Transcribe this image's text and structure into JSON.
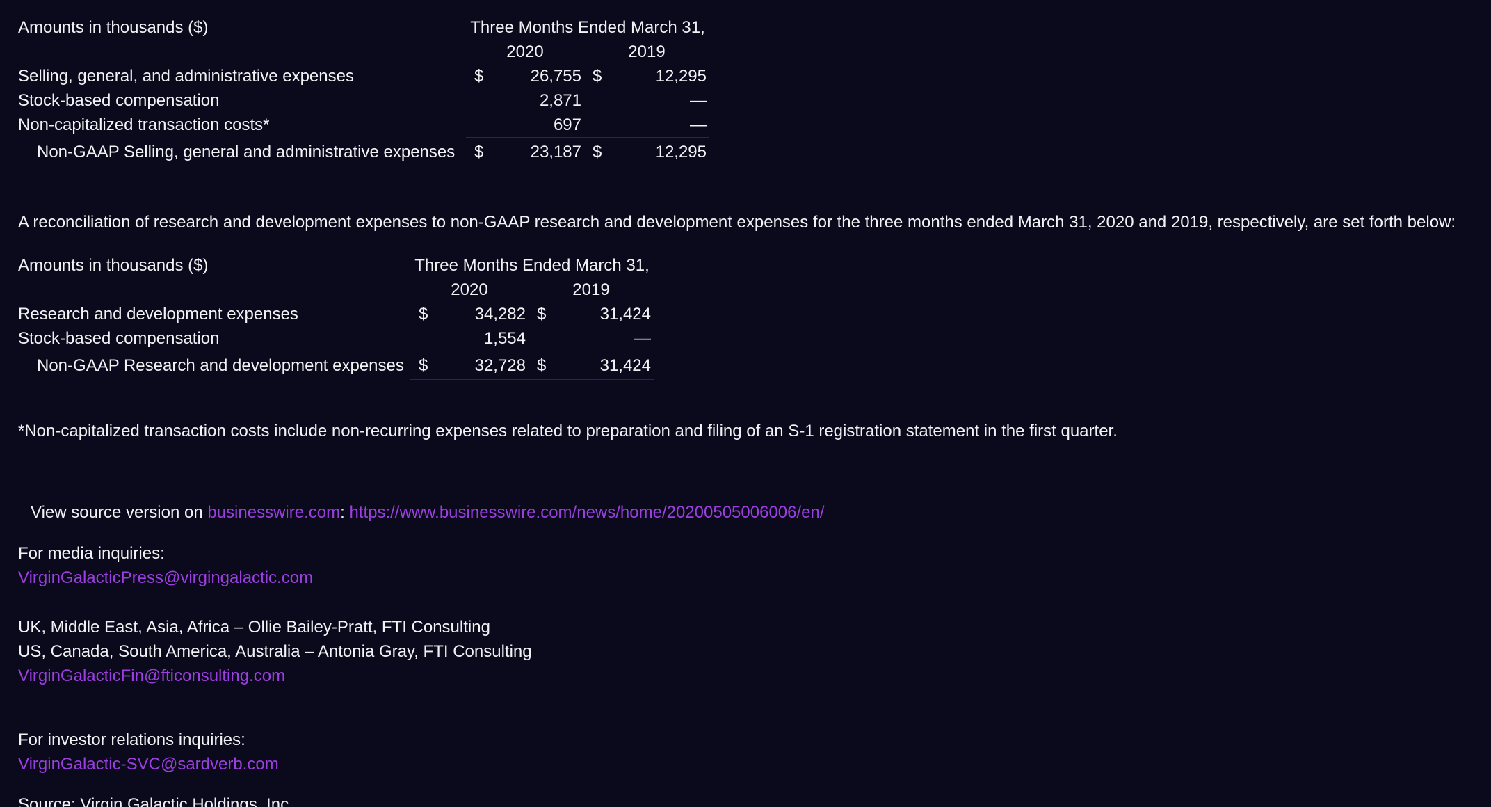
{
  "sga_table": {
    "amounts_label": "Amounts in thousands ($)",
    "period_header": "Three Months Ended March 31,",
    "year_a": "2020",
    "year_b": "2019",
    "rows": [
      {
        "label": "Selling, general, and administrative expenses",
        "cur_a": "$",
        "val_a": "26,755",
        "cur_b": "$",
        "val_b": "12,295"
      },
      {
        "label": "Stock-based compensation",
        "cur_a": "",
        "val_a": "2,871",
        "cur_b": "",
        "val_b": "—"
      },
      {
        "label": "Non-capitalized transaction costs*",
        "cur_a": "",
        "val_a": "697",
        "cur_b": "",
        "val_b": "—"
      }
    ],
    "total": {
      "label": "Non-GAAP Selling, general and administrative expenses",
      "cur_a": "$",
      "val_a": "23,187",
      "cur_b": "$",
      "val_b": "12,295"
    }
  },
  "rd_intro": "A reconciliation of research and development expenses to non-GAAP research and development expenses for the three months ended March 31, 2020 and 2019, respectively, are set forth below:",
  "rd_table": {
    "amounts_label": "Amounts in thousands ($)",
    "period_header": "Three Months Ended March 31,",
    "year_a": "2020",
    "year_b": "2019",
    "rows": [
      {
        "label": "Research and development expenses",
        "cur_a": "$",
        "val_a": "34,282",
        "cur_b": "$",
        "val_b": "31,424"
      },
      {
        "label": "Stock-based compensation",
        "cur_a": "",
        "val_a": "1,554",
        "cur_b": "",
        "val_b": "—"
      }
    ],
    "total": {
      "label": "Non-GAAP Research and development expenses",
      "cur_a": "$",
      "val_a": "32,728",
      "cur_b": "$",
      "val_b": "31,424"
    }
  },
  "footnote": "*Non-capitalized transaction costs include non-recurring expenses related to preparation and filing of an S-1 registration statement in the first quarter.",
  "source_line": {
    "prefix": "View source version on ",
    "site_link": "businesswire.com",
    "separator": ": ",
    "url_link": "https://www.businesswire.com/news/home/20200505006006/en/"
  },
  "media": {
    "heading": "For media inquiries:",
    "email": "VirginGalacticPress@virgingalactic.com"
  },
  "fti": {
    "line1": "UK, Middle East, Asia, Africa – Ollie Bailey-Pratt, FTI Consulting",
    "line2": "US, Canada, South America, Australia – Antonia Gray, FTI Consulting",
    "email": "VirginGalacticFin@fticonsulting.com"
  },
  "investor": {
    "heading": "For investor relations inquiries:",
    "email": "VirginGalactic-SVC@sardverb.com"
  },
  "source": "Source: Virgin Galactic Holdings, Inc.",
  "colors": {
    "background": "#0b0a1c",
    "text": "#f2f2f5",
    "link": "#9b3fe0"
  }
}
